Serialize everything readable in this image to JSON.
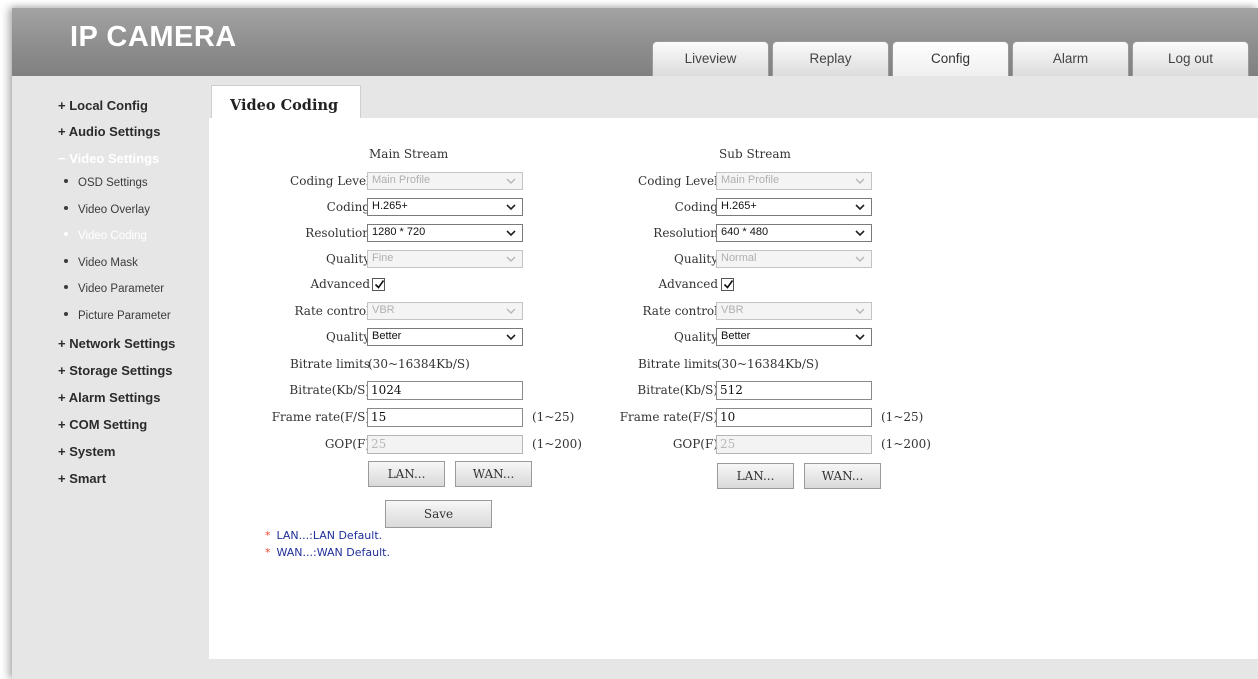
{
  "app": {
    "title": "IP CAMERA"
  },
  "tabs": [
    {
      "label": "Liveview"
    },
    {
      "label": "Replay"
    },
    {
      "label": "Config"
    },
    {
      "label": "Alarm"
    },
    {
      "label": "Log out"
    }
  ],
  "sidebar": {
    "local_config": "+ Local Config",
    "audio_settings": "+ Audio Settings",
    "video_settings": "− Video Settings",
    "sub_items": [
      "OSD Settings",
      "Video Overlay",
      "Video Coding",
      "Video Mask",
      "Video Parameter",
      "Picture Parameter"
    ],
    "network_settings": "+ Network Settings",
    "storage_settings": "+ Storage Settings",
    "alarm_settings": "+ Alarm Settings",
    "com_setting": "+ COM Setting",
    "system": "+ System",
    "smart": "+ Smart"
  },
  "page": {
    "tab_title": "Video Coding"
  },
  "labels": {
    "coding_level": "Coding Level",
    "coding": "Coding",
    "resolution": "Resolution",
    "quality": "Quality",
    "advanced": "Advanced",
    "rate_control": "Rate control",
    "quality2": "Quality",
    "bitrate_limits": "Bitrate limits",
    "bitrate": "Bitrate(Kb/S)",
    "frame_rate": "Frame rate(F/S)",
    "gop": "GOP(F)"
  },
  "main_stream": {
    "heading": "Main Stream",
    "coding_level": "Main Profile",
    "coding": "H.265+",
    "resolution": "1280 * 720",
    "quality": "Fine",
    "advanced_checked": true,
    "rate_control": "VBR",
    "quality2": "Better",
    "bitrate_limits": "(30~16384Kb/S)",
    "bitrate": "1024",
    "frame_rate": "15",
    "frame_rate_range": "(1~25)",
    "gop": "25",
    "gop_range": "(1~200)",
    "lan_button": "LAN...",
    "wan_button": "WAN..."
  },
  "sub_stream": {
    "heading": "Sub Stream",
    "coding_level": "Main Profile",
    "coding": "H.265+",
    "resolution": "640 * 480",
    "quality": "Normal",
    "advanced_checked": true,
    "rate_control": "VBR",
    "quality2": "Better",
    "bitrate_limits": "(30~16384Kb/S)",
    "bitrate": "512",
    "frame_rate": "10",
    "frame_rate_range": "(1~25)",
    "gop": "25",
    "gop_range": "(1~200)",
    "lan_button": "LAN...",
    "wan_button": "WAN..."
  },
  "save_button": "Save",
  "notes": {
    "lan": "LAN...:LAN Default.",
    "wan": "WAN...:WAN Default."
  },
  "colors": {
    "header": "#8e8e8e",
    "background": "#e6e6e6",
    "note_text": "#1f2f9a",
    "note_star": "#e0462b"
  }
}
